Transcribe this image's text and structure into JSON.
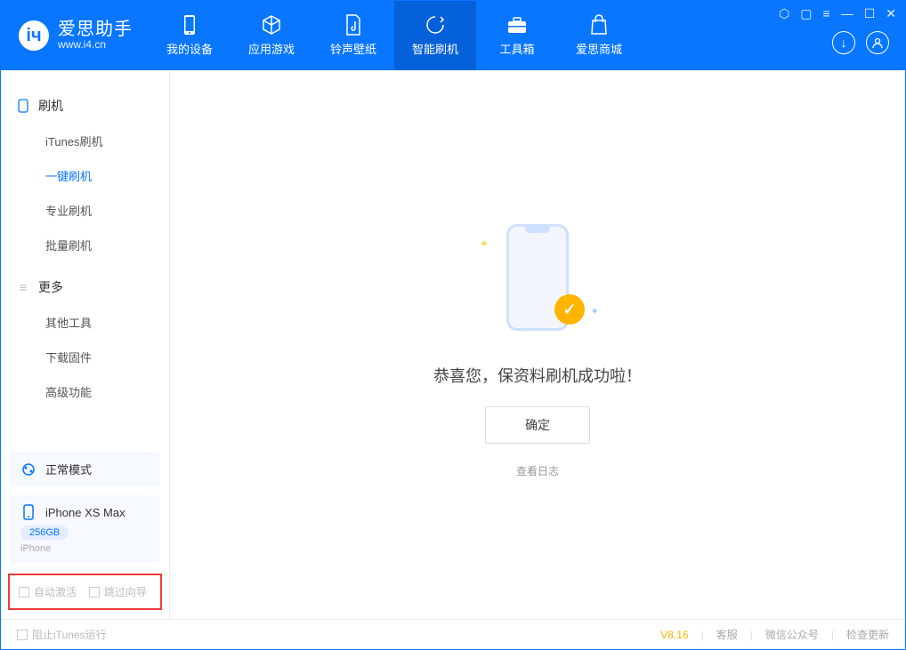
{
  "app": {
    "name": "爱思助手",
    "url": "www.i4.cn"
  },
  "nav": {
    "items": [
      {
        "label": "我的设备"
      },
      {
        "label": "应用游戏"
      },
      {
        "label": "铃声壁纸"
      },
      {
        "label": "智能刷机"
      },
      {
        "label": "工具箱"
      },
      {
        "label": "爱思商城"
      }
    ]
  },
  "sidebar": {
    "section1": {
      "title": "刷机",
      "items": [
        {
          "label": "iTunes刷机"
        },
        {
          "label": "一键刷机"
        },
        {
          "label": "专业刷机"
        },
        {
          "label": "批量刷机"
        }
      ]
    },
    "section2": {
      "title": "更多",
      "items": [
        {
          "label": "其他工具"
        },
        {
          "label": "下载固件"
        },
        {
          "label": "高级功能"
        }
      ]
    },
    "mode_panel": {
      "label": "正常模式"
    },
    "device_panel": {
      "name": "iPhone XS Max",
      "storage": "256GB",
      "type": "iPhone"
    },
    "checks": {
      "auto_activate": "自动激活",
      "skip_guide": "跳过向导"
    }
  },
  "main": {
    "success": "恭喜您，保资料刷机成功啦！",
    "ok": "确定",
    "log": "查看日志"
  },
  "footer": {
    "block_itunes": "阻止iTunes运行",
    "version": "V8.16",
    "links": {
      "service": "客服",
      "wechat": "微信公众号",
      "update": "检查更新"
    }
  }
}
